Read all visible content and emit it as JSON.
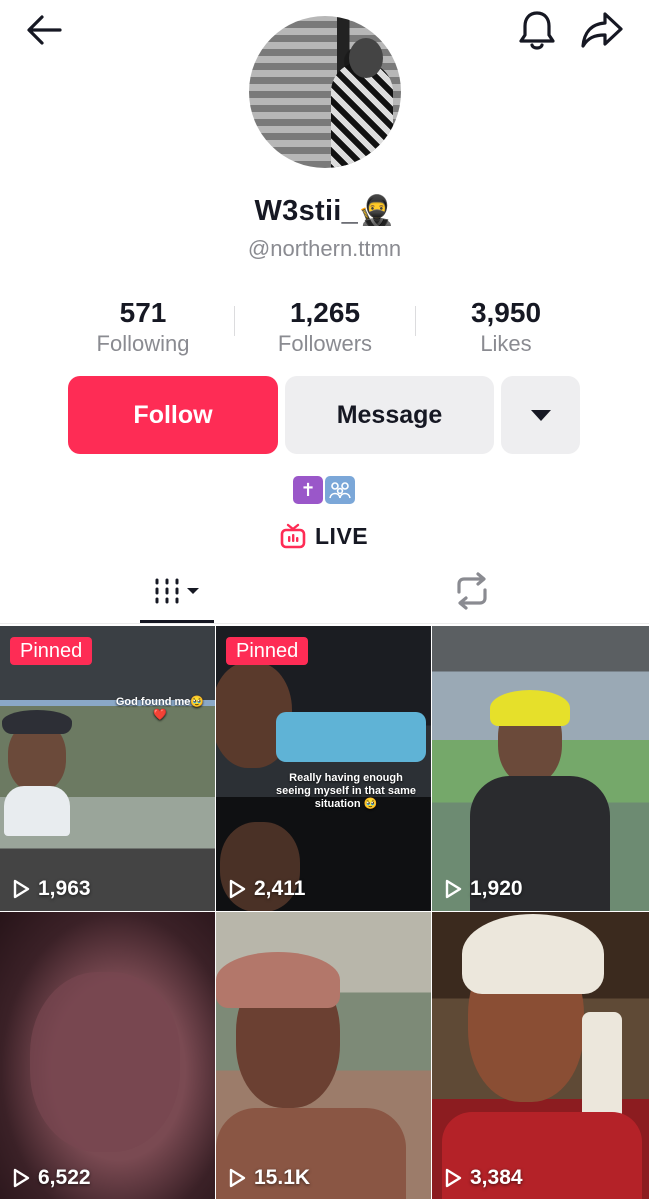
{
  "profile": {
    "display_name": "W3stii_🥷",
    "username": "@northern.ttmn",
    "bio_emoji": [
      "✝️",
      "👨‍👩‍👦"
    ]
  },
  "stats": [
    {
      "value": "571",
      "label": "Following"
    },
    {
      "value": "1,265",
      "label": "Followers"
    },
    {
      "value": "3,950",
      "label": "Likes"
    }
  ],
  "buttons": {
    "follow": "Follow",
    "message": "Message"
  },
  "live": {
    "label": "LIVE"
  },
  "icons": {
    "back": "back-arrow-icon",
    "bell": "bell-icon",
    "share": "share-icon",
    "live": "live-tv-icon",
    "videos_tab": "videos-grid-icon",
    "reposts_tab": "repost-icon",
    "play": "play-icon"
  },
  "colors": {
    "accent": "#fe2c55",
    "secondary_button": "#eeeef0",
    "muted_text": "#8a8b91"
  },
  "videos": [
    {
      "pinned": "Pinned",
      "views": "1,963",
      "caption": "God found me🥹❤️"
    },
    {
      "pinned": "Pinned",
      "views": "2,411",
      "caption": "Really having enough seeing myself in that same situation 🥹"
    },
    {
      "pinned": "",
      "views": "1,920",
      "caption": ""
    },
    {
      "pinned": "",
      "views": "6,522",
      "caption": ""
    },
    {
      "pinned": "",
      "views": "15.1K",
      "caption": ""
    },
    {
      "pinned": "",
      "views": "3,384",
      "caption": ""
    }
  ]
}
